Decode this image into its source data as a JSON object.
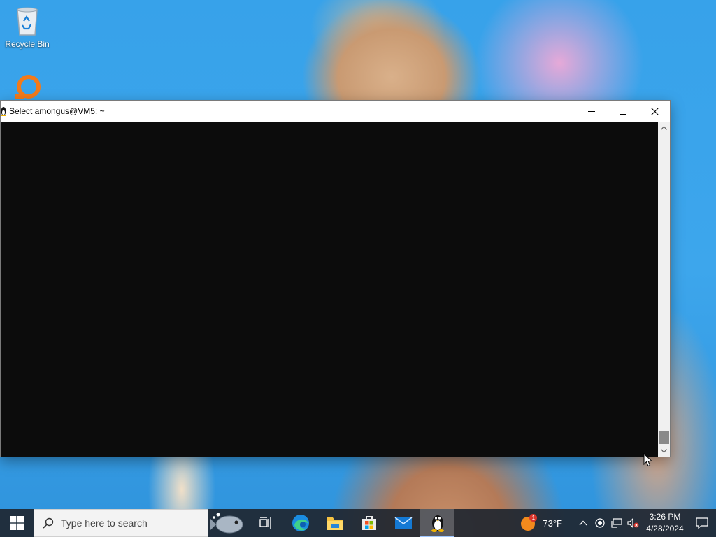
{
  "desktop": {
    "icons": [
      {
        "label": "Recycle Bin",
        "icon": "recycle-bin-icon"
      },
      {
        "label": "",
        "icon": "orange-app-icon"
      }
    ]
  },
  "window": {
    "title": "Select amongus@VM5: ~",
    "app_icon": "tux-icon",
    "controls": [
      "minimize",
      "maximize",
      "close"
    ],
    "terminal_background": "#0c0c0c"
  },
  "taskbar": {
    "search": {
      "placeholder": "Type here to search"
    },
    "apps": [
      "fish-widget",
      "task-view",
      "edge",
      "file-explorer",
      "store",
      "mail",
      "terminal-tux"
    ],
    "weather": {
      "temperature": "73°F",
      "badge": "1"
    },
    "clock": {
      "time": "3:26 PM",
      "date": "4/28/2024"
    }
  },
  "colors": {
    "taskbar": "#20262f",
    "accent": "#0078d7"
  }
}
